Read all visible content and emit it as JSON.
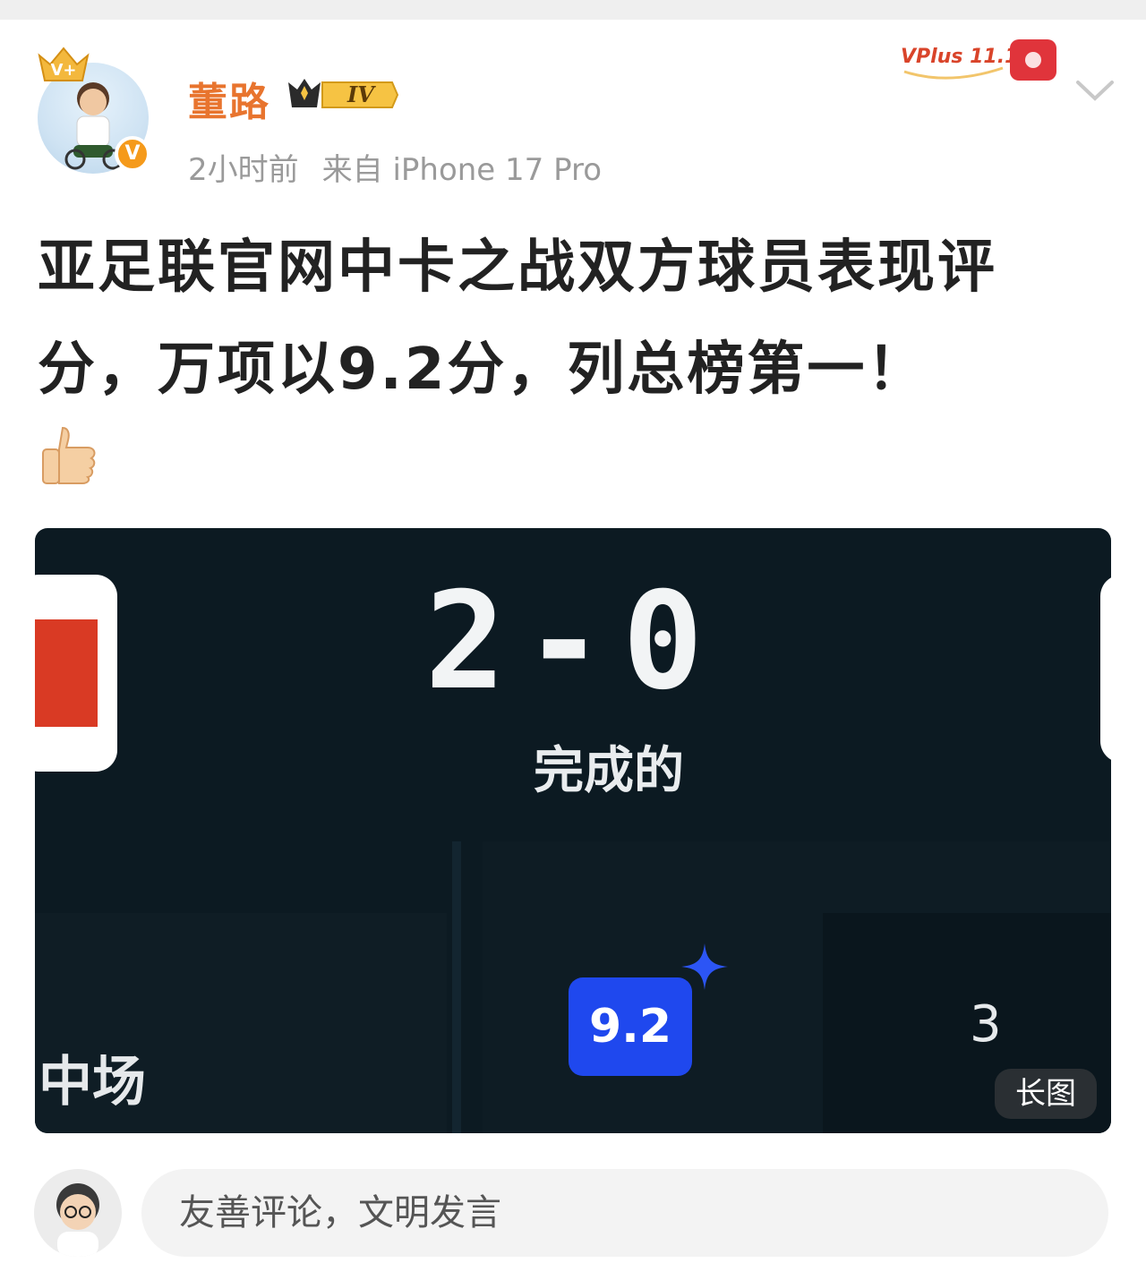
{
  "user": {
    "name": "董路",
    "level": "IV",
    "time": "2小时前",
    "source": "来自 iPhone 17 Pro",
    "verified_mark": "V"
  },
  "promo": {
    "label": "VPlus 11.11"
  },
  "post": {
    "text": "亚足联官网中卡之战双方球员表现评分，万项以9.2分，列总榜第一！"
  },
  "image": {
    "score": "2-0",
    "status": "完成的",
    "position": "中场",
    "rating": "9.2",
    "stat": "3",
    "long_image_tag": "长图"
  },
  "comment": {
    "placeholder": "友善评论，文明发言"
  },
  "colors": {
    "username": "#e8742e",
    "rating_bg": "#1f48ee",
    "card_bg": "#0c1a22"
  }
}
